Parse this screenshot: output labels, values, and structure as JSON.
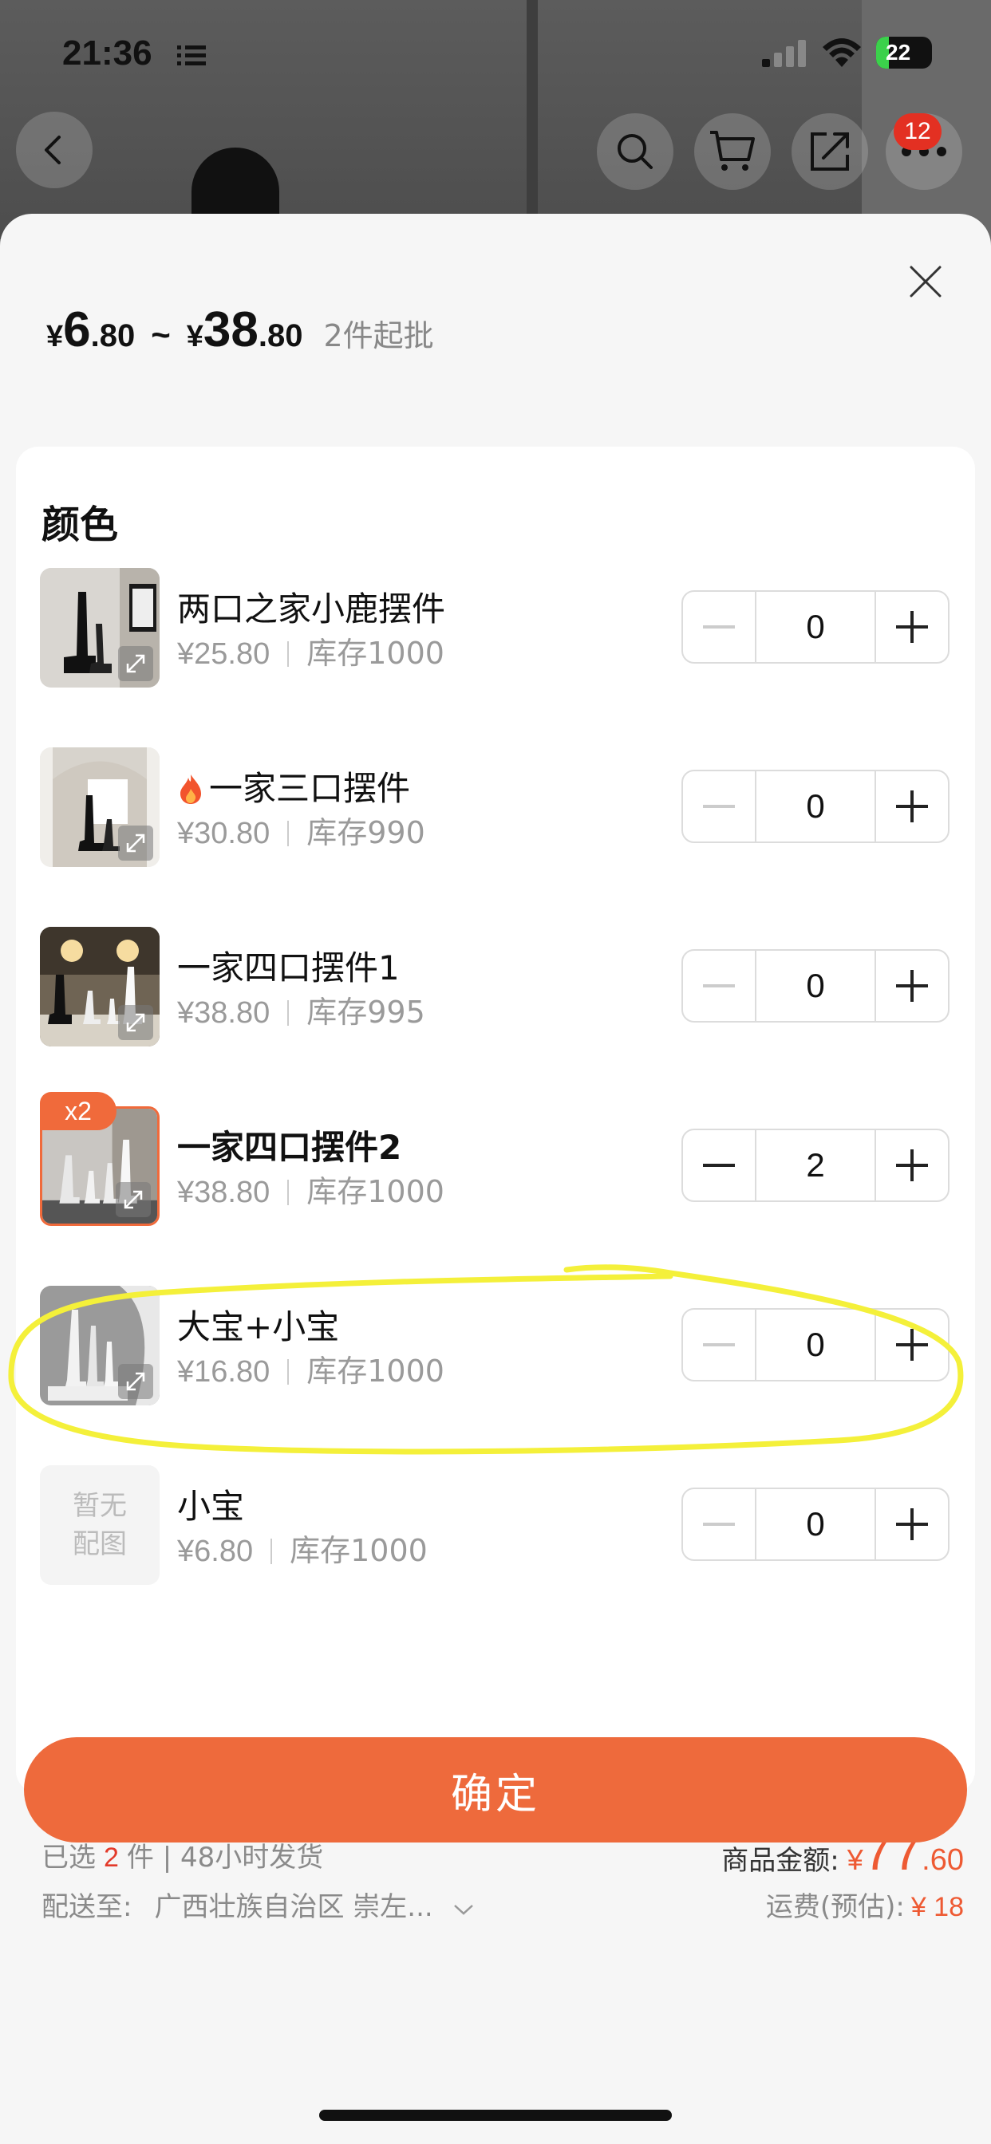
{
  "status_bar": {
    "time": "21:36",
    "battery": "22"
  },
  "header": {
    "cart_badge": "12"
  },
  "sheet": {
    "price": {
      "symbol": "¥",
      "min_int": "6",
      "min_dec": ".80",
      "tilde": "~",
      "max_int": "38",
      "max_dec": ".80",
      "min_order": "2件起批"
    },
    "section_title": "颜色",
    "placeholder_text": "暂无配图",
    "items": [
      {
        "name": "两口之家小鹿摆件",
        "price": "¥25.80",
        "stock": "库存1000",
        "qty": "0"
      },
      {
        "name": "一家三口摆件",
        "price": "¥30.80",
        "stock": "库存990",
        "qty": "0"
      },
      {
        "name": "一家四口摆件1",
        "price": "¥38.80",
        "stock": "库存995",
        "qty": "0"
      },
      {
        "name": "一家四口摆件2",
        "price": "¥38.80",
        "stock": "库存1000",
        "qty": "2",
        "badge": "x2"
      },
      {
        "name": "大宝+小宝",
        "price": "¥16.80",
        "stock": "库存1000",
        "qty": "0"
      },
      {
        "name": "小宝",
        "price": "¥6.80",
        "stock": "库存1000",
        "qty": "0"
      }
    ]
  },
  "footer": {
    "selected_prefix": "已选",
    "selected_count": "2",
    "selected_suffix": "件 | 48小时发货",
    "ship_label": "配送至:",
    "ship_address": "广西壮族自治区 崇左...",
    "amount_label": "商品金额:",
    "amount_symbol": "¥",
    "amount_int": "77",
    "amount_dec": ".60",
    "freight_label": "运费(预估):",
    "freight_value": "¥ 18",
    "confirm": "确定"
  },
  "colors": {
    "accent": "#ee6a3c",
    "price_red": "#e33a2a",
    "highlight": "#f4f03a"
  },
  "icons": [
    "list-icon",
    "signal-icon",
    "wifi-icon",
    "back-icon",
    "search-icon",
    "cart-icon",
    "share-icon",
    "more-icon",
    "close-icon",
    "expand-icon",
    "minus-icon",
    "plus-icon",
    "fire-icon",
    "chevron-down-icon"
  ]
}
